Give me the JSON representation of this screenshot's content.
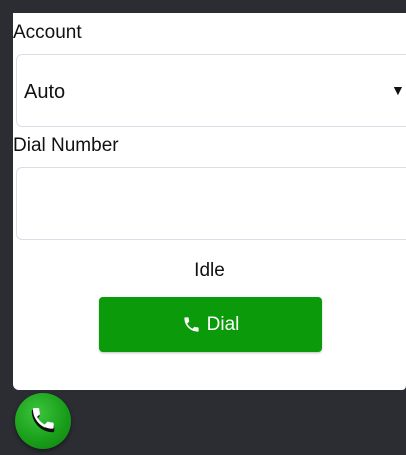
{
  "account": {
    "label": "Account",
    "selected": "Auto"
  },
  "dial": {
    "label": "Dial Number",
    "value": "",
    "placeholder": ""
  },
  "status": "Idle",
  "dial_button": {
    "label": "Dial",
    "icon": "phone-icon",
    "color": "#0a9a0a"
  },
  "fab": {
    "icon": "phone-icon",
    "color": "#1aa01a"
  },
  "colors": {
    "background": "#2b2d33",
    "panel": "#ffffff",
    "border": "#dcdce6"
  }
}
